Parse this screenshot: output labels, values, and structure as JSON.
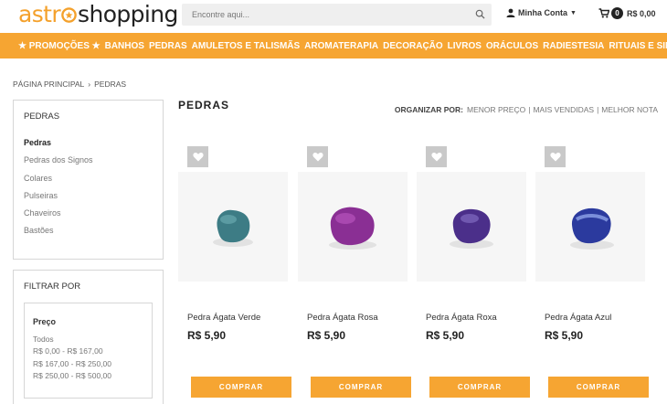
{
  "header": {
    "logo_left": "astr",
    "logo_right": "shopping",
    "search_placeholder": "Encontre aqui...",
    "account_label": "Minha Conta",
    "cart_count": "0",
    "cart_total": "R$ 0,00"
  },
  "nav": {
    "items": [
      "★ PROMOÇÕES ★",
      "BANHOS",
      "PEDRAS",
      "AMULETOS E TALISMÃS",
      "AROMATERAPIA",
      "DECORAÇÃO",
      "LIVROS",
      "ORÁCULOS",
      "RADIESTESIA",
      "RITUAIS E SIMPATIAS"
    ]
  },
  "breadcrumb": {
    "home": "PÁGINA PRINCIPAL",
    "separator": "›",
    "current": "PEDRAS"
  },
  "sidebar": {
    "categories_title": "PEDRAS",
    "categories": [
      "Pedras",
      "Pedras dos Signos",
      "Colares",
      "Pulseiras",
      "Chaveiros",
      "Bastões"
    ],
    "filter_title": "FILTRAR POR",
    "price_title": "Preço",
    "price_options": [
      "Todos",
      "R$ 0,00 - R$ 167,00",
      "R$ 167,00 - R$ 250,00",
      "R$ 250,00 - R$ 500,00"
    ]
  },
  "main": {
    "title": "PEDRAS",
    "sort_label": "ORGANIZAR POR:",
    "sort_options": [
      "MENOR PREÇO",
      "MAIS VENDIDAS",
      "MELHOR NOTA"
    ],
    "sort_divider": "|",
    "buy_label": "COMPRAR",
    "products": [
      {
        "name": "Pedra Ágata Verde",
        "price": "R$ 5,90",
        "stone_color": "#3d7c85",
        "stone_highlight": "#6fb0b5"
      },
      {
        "name": "Pedra Ágata Rosa",
        "price": "R$ 5,90",
        "stone_color": "#8a2f94",
        "stone_highlight": "#c35dc7"
      },
      {
        "name": "Pedra Ágata Roxa",
        "price": "R$ 5,90",
        "stone_color": "#4b2f8a",
        "stone_highlight": "#8f7ad0"
      },
      {
        "name": "Pedra Ágata Azul",
        "price": "R$ 5,90",
        "stone_color": "#2b3a9e",
        "stone_highlight": "#8fa4e8"
      }
    ]
  },
  "colors": {
    "accent": "#f6a532",
    "logo_orange": "#f4a12c"
  }
}
